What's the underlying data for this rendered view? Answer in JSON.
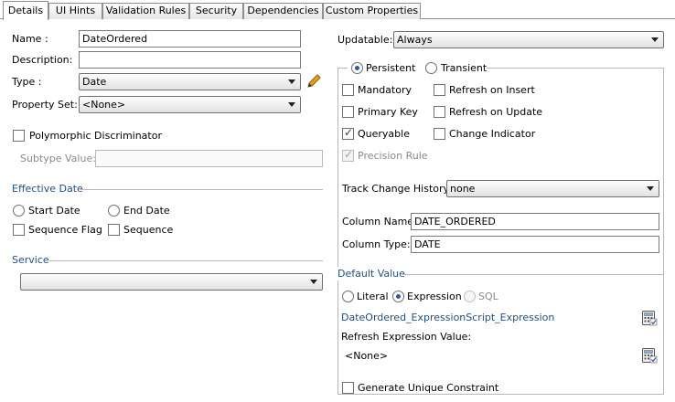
{
  "tabs": [
    {
      "label": "Details"
    },
    {
      "label": "UI Hints"
    },
    {
      "label": "Validation Rules"
    },
    {
      "label": "Security"
    },
    {
      "label": "Dependencies"
    },
    {
      "label": "Custom Properties"
    }
  ],
  "left": {
    "name_label": "Name :",
    "name_value": "DateOrdered",
    "description_label": "Description:",
    "description_value": "",
    "type_label": "Type :",
    "type_value": "Date",
    "property_set_label": "Property Set:",
    "property_set_value": "<None>",
    "polymorphic_label": "Polymorphic Discriminator",
    "subtype_label": "Subtype Value:",
    "subtype_value": "",
    "effective_date_header": "Effective Date",
    "start_date_label": "Start Date",
    "end_date_label": "End Date",
    "sequence_flag_label": "Sequence Flag",
    "sequence_label": "Sequence",
    "service_header": "Service",
    "service_value": ""
  },
  "right": {
    "updatable_label": "Updatable:",
    "updatable_value": "Always",
    "persistent_label": "Persistent",
    "transient_label": "Transient",
    "mandatory_label": "Mandatory",
    "refresh_insert_label": "Refresh on Insert",
    "primary_key_label": "Primary Key",
    "refresh_update_label": "Refresh on Update",
    "queryable_label": "Queryable",
    "change_indicator_label": "Change Indicator",
    "precision_rule_label": "Precision Rule",
    "track_change_label": "Track Change History:",
    "track_change_value": "none",
    "column_name_label": "Column Name:",
    "column_name_value": "DATE_ORDERED",
    "column_type_label": "Column Type:",
    "column_type_value": "DATE",
    "default_value_header": "Default Value",
    "literal_label": "Literal",
    "expression_label": "Expression",
    "sql_label": "SQL",
    "expression_link": "DateOrdered_ExpressionScript_Expression",
    "refresh_expression_label": "Refresh Expression Value:",
    "refresh_expression_value": "<None>",
    "generate_unique_label": "Generate Unique Constraint"
  },
  "colors": {
    "accent_blue": "#1f4f8a",
    "radio_dot": "#2e57a4",
    "separator": "#b8b8b8",
    "pencil": "#e8a317"
  },
  "icons": {
    "edit": "pencil-icon",
    "expression_editor": "calculator-icon"
  }
}
